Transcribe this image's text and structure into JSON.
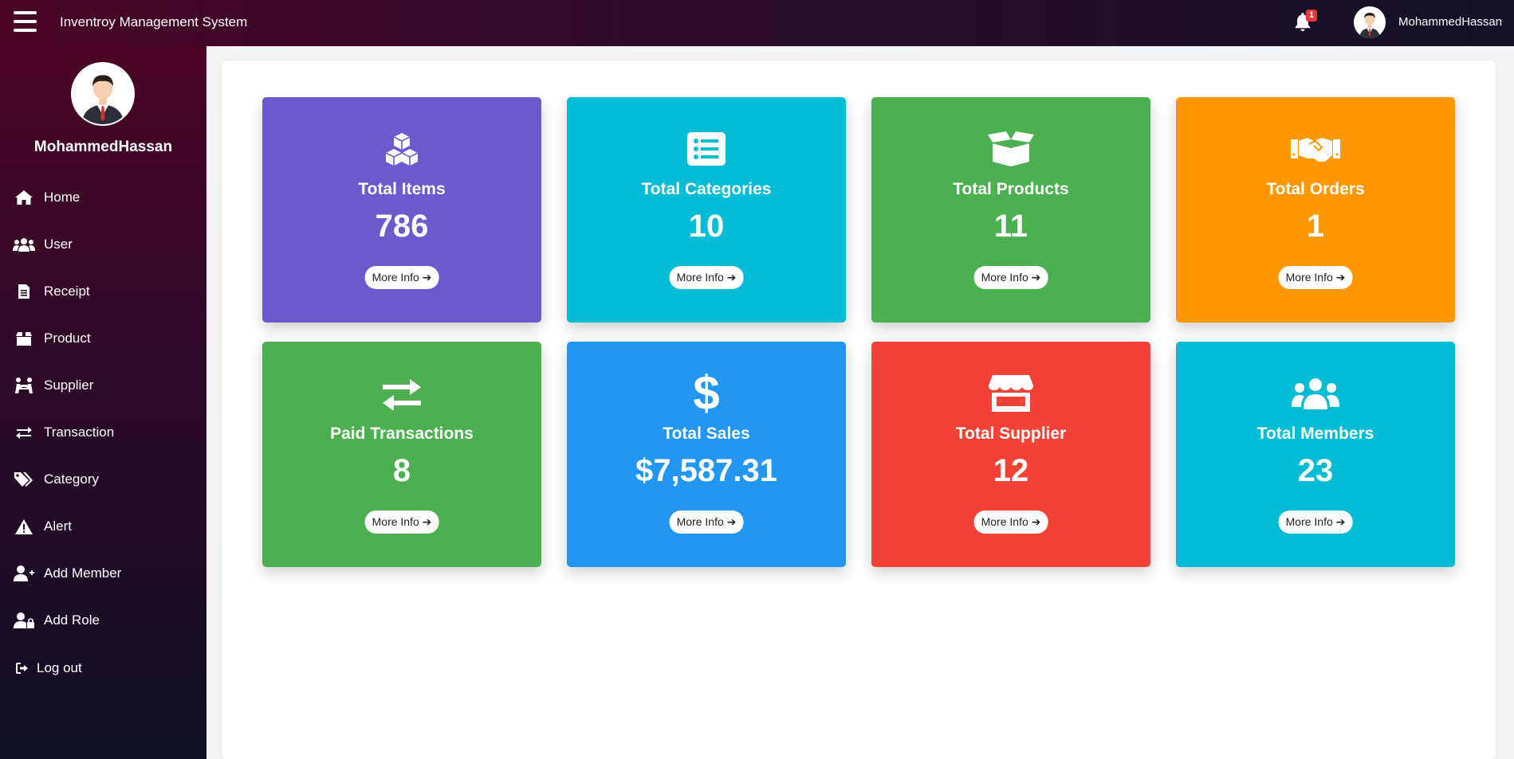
{
  "header": {
    "app_title": "Inventroy Management System",
    "notification_count": "1",
    "username": "MohammedHassan"
  },
  "sidebar": {
    "username": "MohammedHassan",
    "items": [
      {
        "label": "Home",
        "icon": "home-icon"
      },
      {
        "label": "User",
        "icon": "users-icon"
      },
      {
        "label": "Receipt",
        "icon": "receipt-icon"
      },
      {
        "label": "Product",
        "icon": "box-icon"
      },
      {
        "label": "Supplier",
        "icon": "supplier-icon"
      },
      {
        "label": "Transaction",
        "icon": "exchange-icon"
      },
      {
        "label": "Category",
        "icon": "tags-icon"
      },
      {
        "label": "Alert",
        "icon": "warning-icon"
      },
      {
        "label": "Add Member",
        "icon": "user-plus-icon"
      },
      {
        "label": "Add Role",
        "icon": "user-lock-icon"
      },
      {
        "label": "Log out",
        "icon": "sign-out-icon"
      }
    ]
  },
  "tiles": [
    {
      "title": "Total Items",
      "value": "786",
      "button": "More Info",
      "icon": "cubes-icon",
      "color": "#6a5acd"
    },
    {
      "title": "Total Categories",
      "value": "10",
      "button": "More Info",
      "icon": "list-icon",
      "color": "#00bcd4"
    },
    {
      "title": "Total Products",
      "value": "11",
      "button": "More Info",
      "icon": "open-box-icon",
      "color": "#4caf50"
    },
    {
      "title": "Total Orders",
      "value": "1",
      "button": "More Info",
      "icon": "handshake-icon",
      "color": "#ff9800"
    },
    {
      "title": "Paid Transactions",
      "value": "8",
      "button": "More Info",
      "icon": "exchange-icon",
      "color": "#4caf50"
    },
    {
      "title": "Total Sales",
      "value": "$7,587.31",
      "button": "More Info",
      "icon": "dollar-icon",
      "color": "#2196f3"
    },
    {
      "title": "Total Supplier",
      "value": "12",
      "button": "More Info",
      "icon": "store-icon",
      "color": "#f44336"
    },
    {
      "title": "Total Members",
      "value": "23",
      "button": "More Info",
      "icon": "users-icon",
      "color": "#00bcd4"
    }
  ]
}
